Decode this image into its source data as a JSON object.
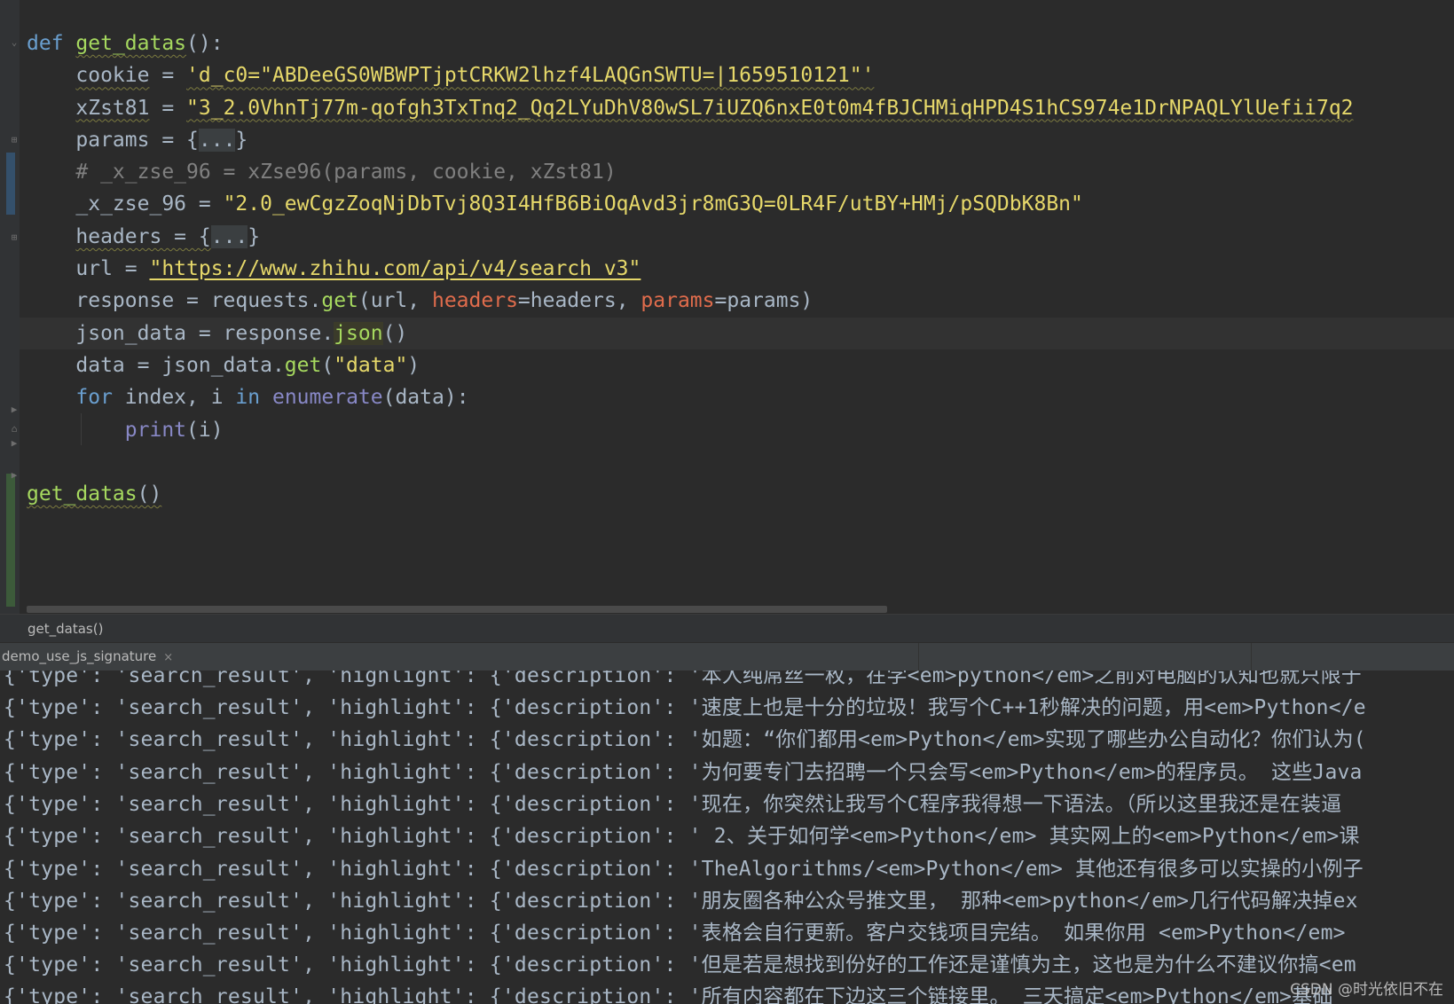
{
  "editor": {
    "lines": {
      "l1_def": "def",
      "l1_name": "get_datas",
      "l1_tail": "():",
      "l2_var": "cookie",
      "l2_eq": " = ",
      "l2_val": "'d_c0=\"ABDeeGS0WBWPTjptCRKW2lhzf4LAQGnSWTU=|1659510121\"'",
      "l3_var": "xZst81",
      "l3_eq": " = ",
      "l3_val": "\"3_2.0VhnTj77m-qofgh3TxTnq2_Qq2LYuDhV80wSL7iUZQ6nxE0t0m4fBJCHMiqHPD4S1hCS974e1DrNPAQLYlUefii7q2",
      "l4_var": "params = {",
      "l4_fold": "...",
      "l4_end": "}",
      "l5": "# _x_zse_96 = xZse96(params, cookie, xZst81)",
      "l6_var": "_x_zse_96 = ",
      "l6_val": "\"2.0_ewCgzZoqNjDbTvj8Q3I4HfB6BiOqAvd3jr8mG3Q=0LR4F/utBY+HMj/pSQDbK8Bn\"",
      "l7_var": "headers = {",
      "l7_fold": "...",
      "l7_end": "}",
      "l8_var": "url = ",
      "l8_val": "\"https://www.zhihu.com/api/v4/search_v3\"",
      "l9_a": "response = requests.",
      "l9_get": "get",
      "l9_b": "(url, ",
      "l9_p1": "headers",
      "l9_c": "=headers, ",
      "l9_p2": "params",
      "l9_d": "=params)",
      "l10_a": "json_data = response.",
      "l10_json": "json",
      "l10_b": "()",
      "l11_a": "data = json_data.",
      "l11_get": "get",
      "l11_b": "(",
      "l11_str": "\"data\"",
      "l11_c": ")",
      "l12_for": "for",
      "l12_a": " index, i ",
      "l12_in": "in",
      "l12_sp": " ",
      "l12_enum": "enumerate",
      "l12_b": "(data):",
      "l13_print": "print",
      "l13_b": "(i)",
      "l15_call": "get_datas",
      "l15_b": "()"
    }
  },
  "breadcrumb": {
    "label": "get_datas()"
  },
  "run_tab": {
    "label": "demo_use_js_signature",
    "close": "×"
  },
  "console": {
    "prefix": "{'type': 'search_result', 'highlight': {'description': ",
    "lines": [
      "'本人纯屌丝一枚，在学<em>python</em>之前对电脑的认知也就只限于",
      "'速度上也是十分的垃圾！我写个C++1秒解决的问题，用<em>Python</e",
      "'如题：“你们都用<em>Python</em>实现了哪些办公自动化？你们认为(",
      "'为何要专门去招聘一个只会写<em>Python</em>的程序员。 这些Java",
      "'现在，你突然让我写个C程序我得想一下语法。（所以这里我还是在装逼",
      "' 2、关于如何学<em>Python</em> 其实网上的<em>Python</em>课",
      "'TheAlgorithms/<em>Python</em> 其他还有很多可以实操的小例子",
      "'朋友圈各种公众号推文里， 那种<em>python</em>几行代码解决掉ex",
      "'表格会自行更新。客户交钱项目完结。 如果你用 <em>Python</em> ",
      "'但是若是想找到份好的工作还是谨慎为主，这也是为什么不建议你搞<em",
      "'所有内容都在下边这三个链接里。 三天搞定<em>Python</em>基础"
    ]
  },
  "watermark": "CSDN @时光依旧不在"
}
